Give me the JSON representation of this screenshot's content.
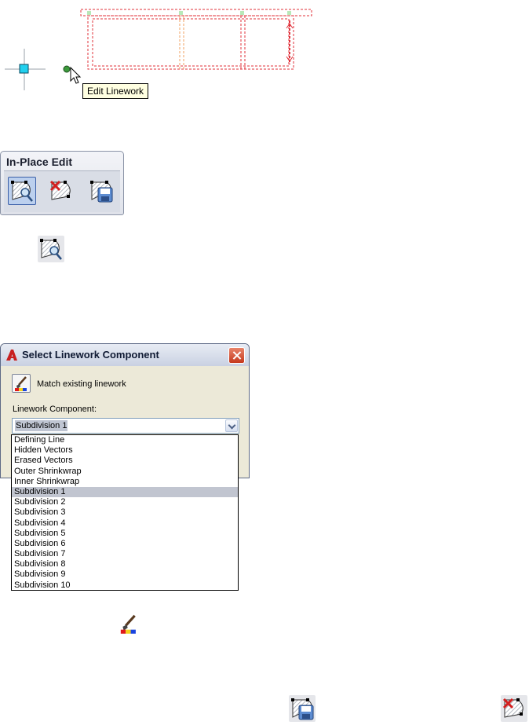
{
  "canvas": {
    "tooltip": "Edit Linework"
  },
  "toolbar": {
    "title": "In-Place Edit",
    "buttons": [
      {
        "icon": "edit-linework-icon"
      },
      {
        "icon": "cancel-edit-icon"
      },
      {
        "icon": "save-edit-icon"
      }
    ]
  },
  "dialog": {
    "title": "Select Linework Component",
    "app_icon": "autocad-app-icon",
    "match_label": "Match existing linework",
    "component_label": "Linework Component:",
    "selected_value": "Subdivision 1",
    "options": [
      "Defining Line",
      "Hidden Vectors",
      "Erased Vectors",
      "Outer Shrinkwrap",
      "Inner Shrinkwrap",
      "Subdivision 1",
      "Subdivision 2",
      "Subdivision 3",
      "Subdivision 4",
      "Subdivision 5",
      "Subdivision 6",
      "Subdivision 7",
      "Subdivision 8",
      "Subdivision 9",
      "Subdivision 10"
    ]
  },
  "colors": {
    "dashed_red": "#e0303a",
    "dashed_orange": "#f0a060",
    "grip_cyan": "#22d0ee",
    "grip_green": "#3c9a3c",
    "selected_highlight": "#c1c5d0"
  }
}
